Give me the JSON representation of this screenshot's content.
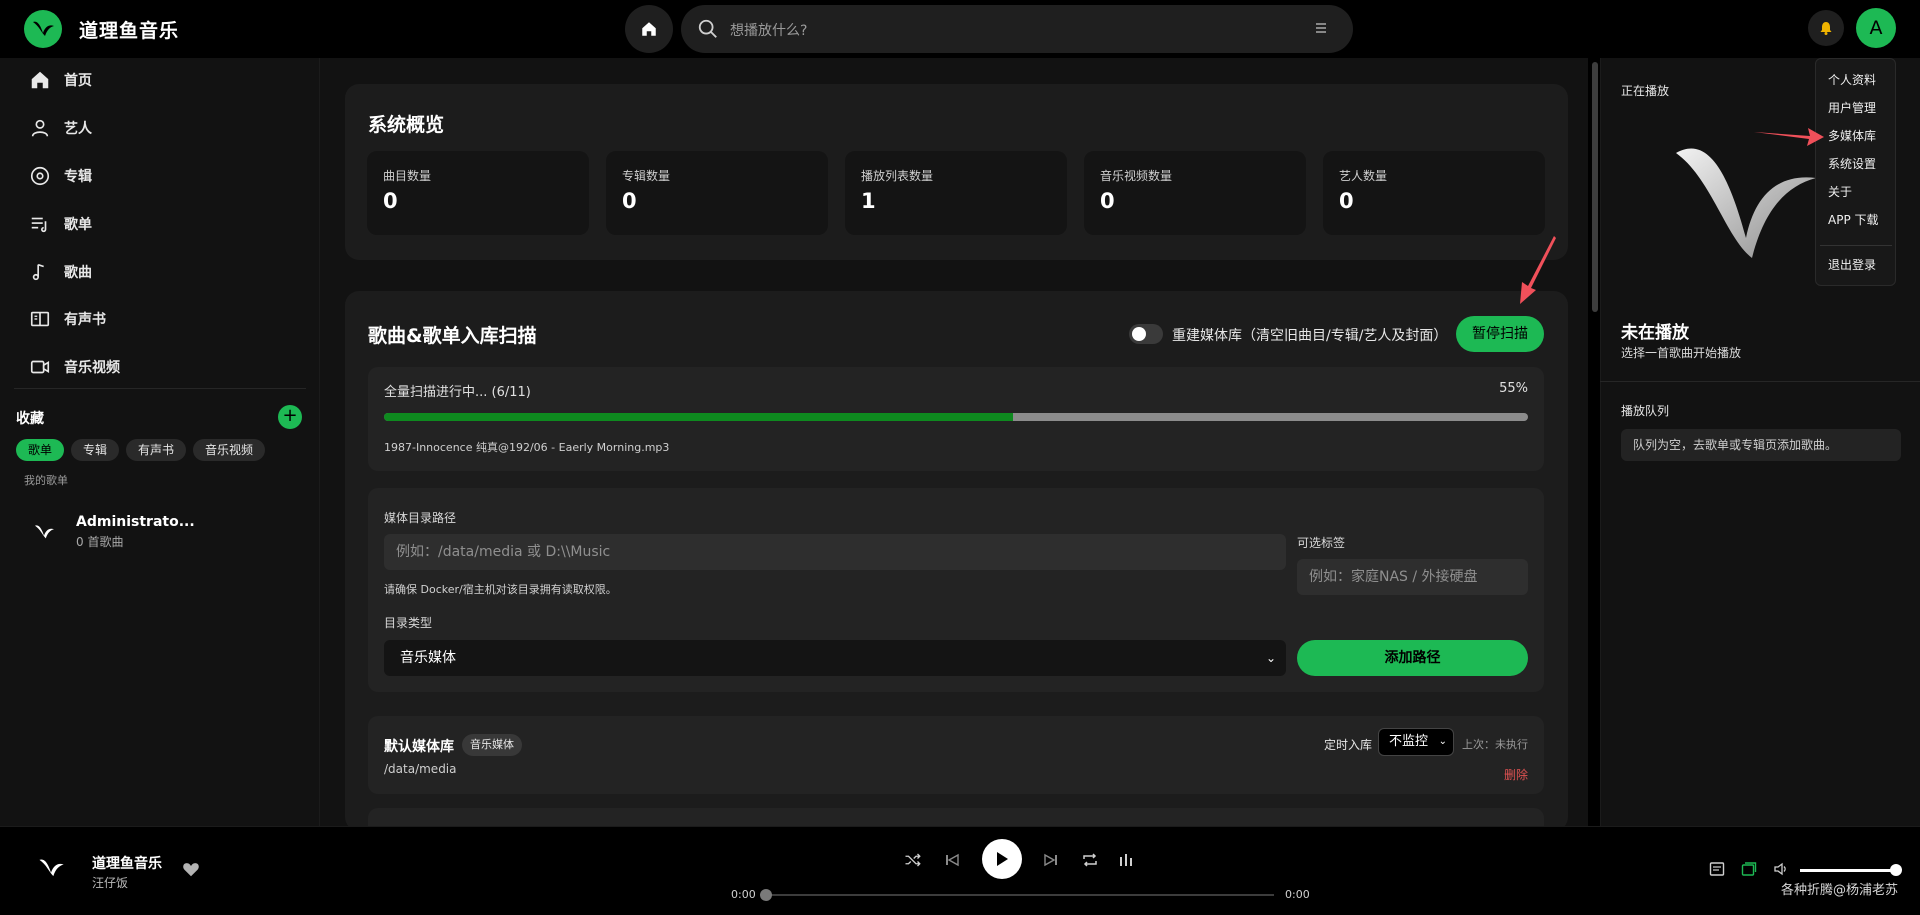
{
  "app": {
    "title": "道理鱼音乐"
  },
  "search": {
    "placeholder": "想播放什么?"
  },
  "avatar": {
    "letter": "A"
  },
  "sidebar": {
    "nav": [
      {
        "label": "首页",
        "icon": "home-icon"
      },
      {
        "label": "艺人",
        "icon": "person-icon"
      },
      {
        "label": "专辑",
        "icon": "disc-icon"
      },
      {
        "label": "歌单",
        "icon": "playlist-icon"
      },
      {
        "label": "歌曲",
        "icon": "music-note-icon"
      },
      {
        "label": "有声书",
        "icon": "book-icon"
      },
      {
        "label": "音乐视频",
        "icon": "video-icon"
      }
    ],
    "favorites_title": "收藏",
    "chips": [
      "歌单",
      "专辑",
      "有声书",
      "音乐视频"
    ],
    "my_playlists_label": "我的歌单",
    "playlist": {
      "name": "Administrato...",
      "count": "0 首歌曲"
    }
  },
  "overview": {
    "title": "系统概览",
    "stats": [
      {
        "label": "曲目数量",
        "value": "0"
      },
      {
        "label": "专辑数量",
        "value": "0"
      },
      {
        "label": "播放列表数量",
        "value": "1"
      },
      {
        "label": "音乐视频数量",
        "value": "0"
      },
      {
        "label": "艺人数量",
        "value": "0"
      }
    ]
  },
  "scan": {
    "title": "歌曲&歌单入库扫描",
    "rebuild_label": "重建媒体库（清空旧曲目/专辑/艺人及封面）",
    "rebuild_on": false,
    "pause_label": "暂停扫描",
    "progress_text": "全量扫描进行中... (6/11)",
    "progress_pct_text": "55%",
    "progress_value": 0.55,
    "current_file": "1987-Innocence 纯真@192/06 - Eaerly Morning.mp3",
    "path_label": "媒体目录路径",
    "path_placeholder": "例如：/data/media 或 D:\\\\Music",
    "path_hint": "请确保 Docker/宿主机对该目录拥有读取权限。",
    "tag_label": "可选标签",
    "tag_placeholder": "例如：家庭NAS / 外接硬盘",
    "dir_type_label": "目录类型",
    "dir_type_value": "音乐媒体",
    "add_path_label": "添加路径"
  },
  "library": {
    "name": "默认媒体库",
    "badge": "音乐媒体",
    "path": "/data/media",
    "schedule_label": "定时入库",
    "schedule_value": "不监控",
    "last_run": "上次：未执行",
    "delete_label": "删除"
  },
  "now_playing": {
    "label": "正在播放",
    "title": "未在播放",
    "subtitle": "选择一首歌曲开始播放",
    "queue_label": "播放队列",
    "queue_empty": "队列为空，去歌单或专辑页添加歌曲。"
  },
  "user_menu": [
    "个人资料",
    "用户管理",
    "多媒体库",
    "系统设置",
    "关于",
    "APP 下载",
    "退出登录"
  ],
  "player": {
    "title": "道理鱼音乐",
    "artist": "汪仔饭",
    "time_current": "0:00",
    "time_total": "0:00",
    "volume": 0.94
  },
  "watermark": "各种折腾@杨浦老苏",
  "colors": {
    "accent": "#1db954",
    "progress": "#0e8a1f",
    "danger": "#e05252",
    "annotation": "#f0505a"
  }
}
